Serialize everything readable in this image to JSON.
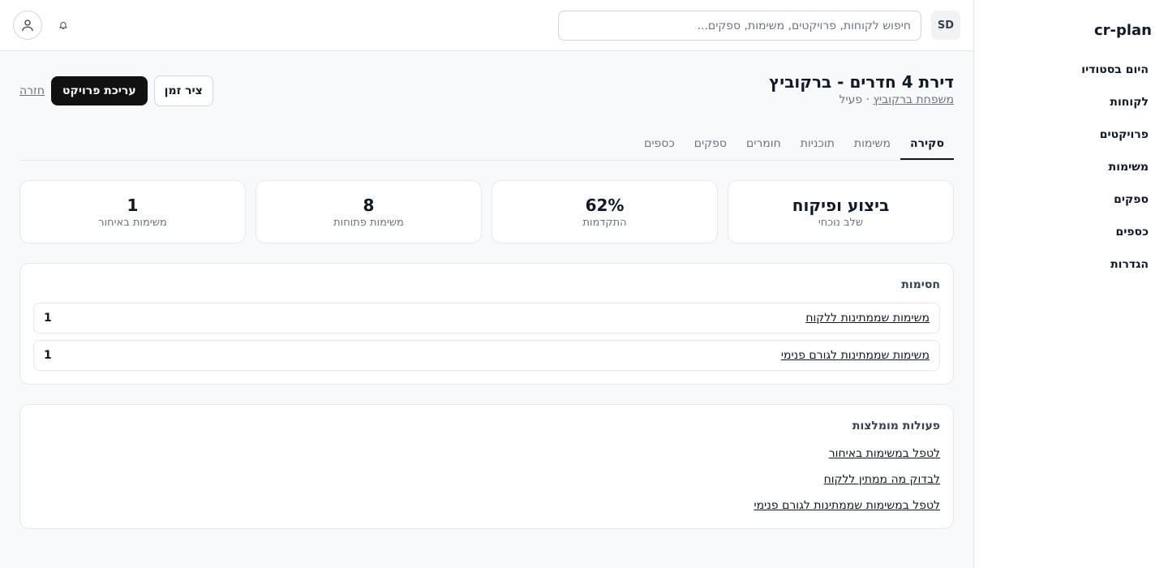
{
  "app": {
    "brand": "cr-plan"
  },
  "sidebar": {
    "items": [
      {
        "label": "היום בסטודיו"
      },
      {
        "label": "לקוחות"
      },
      {
        "label": "פרויקטים"
      },
      {
        "label": "משימות"
      },
      {
        "label": "ספקים"
      },
      {
        "label": "כספים"
      },
      {
        "label": "הגדרות"
      }
    ]
  },
  "topbar": {
    "search_placeholder": "חיפוש לקוחות, פרויקטים, משימות, ספקים...",
    "avatar_initials": "SD",
    "icons": {
      "user": "user-icon",
      "bell": "bell-icon"
    }
  },
  "project": {
    "title": "דירת 4 חדרים - ברקוביץ",
    "client": "משפחת ברקוביץ",
    "separator": " · ",
    "status": "פעיל"
  },
  "actions": {
    "back": "חזרה",
    "edit": "עריכת פרויקט",
    "timeline": "ציר זמן"
  },
  "tabs": [
    {
      "label": "סקירה",
      "active": true
    },
    {
      "label": "משימות"
    },
    {
      "label": "תוכניות"
    },
    {
      "label": "חומרים"
    },
    {
      "label": "ספקים"
    },
    {
      "label": "כספים"
    }
  ],
  "stats": [
    {
      "value": "ביצוע ופיקוח",
      "label": "שלב נוכחי"
    },
    {
      "value": "62%",
      "label": "התקדמות"
    },
    {
      "value": "8",
      "label": "משימות פתוחות"
    },
    {
      "value": "1",
      "label": "משימות באיחור"
    }
  ],
  "blockers": {
    "title": "חסימות",
    "rows": [
      {
        "label": "משימות שממתינות ללקוח",
        "count": "1"
      },
      {
        "label": "משימות שממתינות לגורם פנימי",
        "count": "1"
      }
    ]
  },
  "recommendations": {
    "title": "פעולות מומלצות",
    "items": [
      {
        "label": "לטפל במשימות באיחור"
      },
      {
        "label": "לבדוק מה ממתין ללקוח"
      },
      {
        "label": "לטפל במשימות שממתינות לגורם פנימי"
      }
    ]
  }
}
